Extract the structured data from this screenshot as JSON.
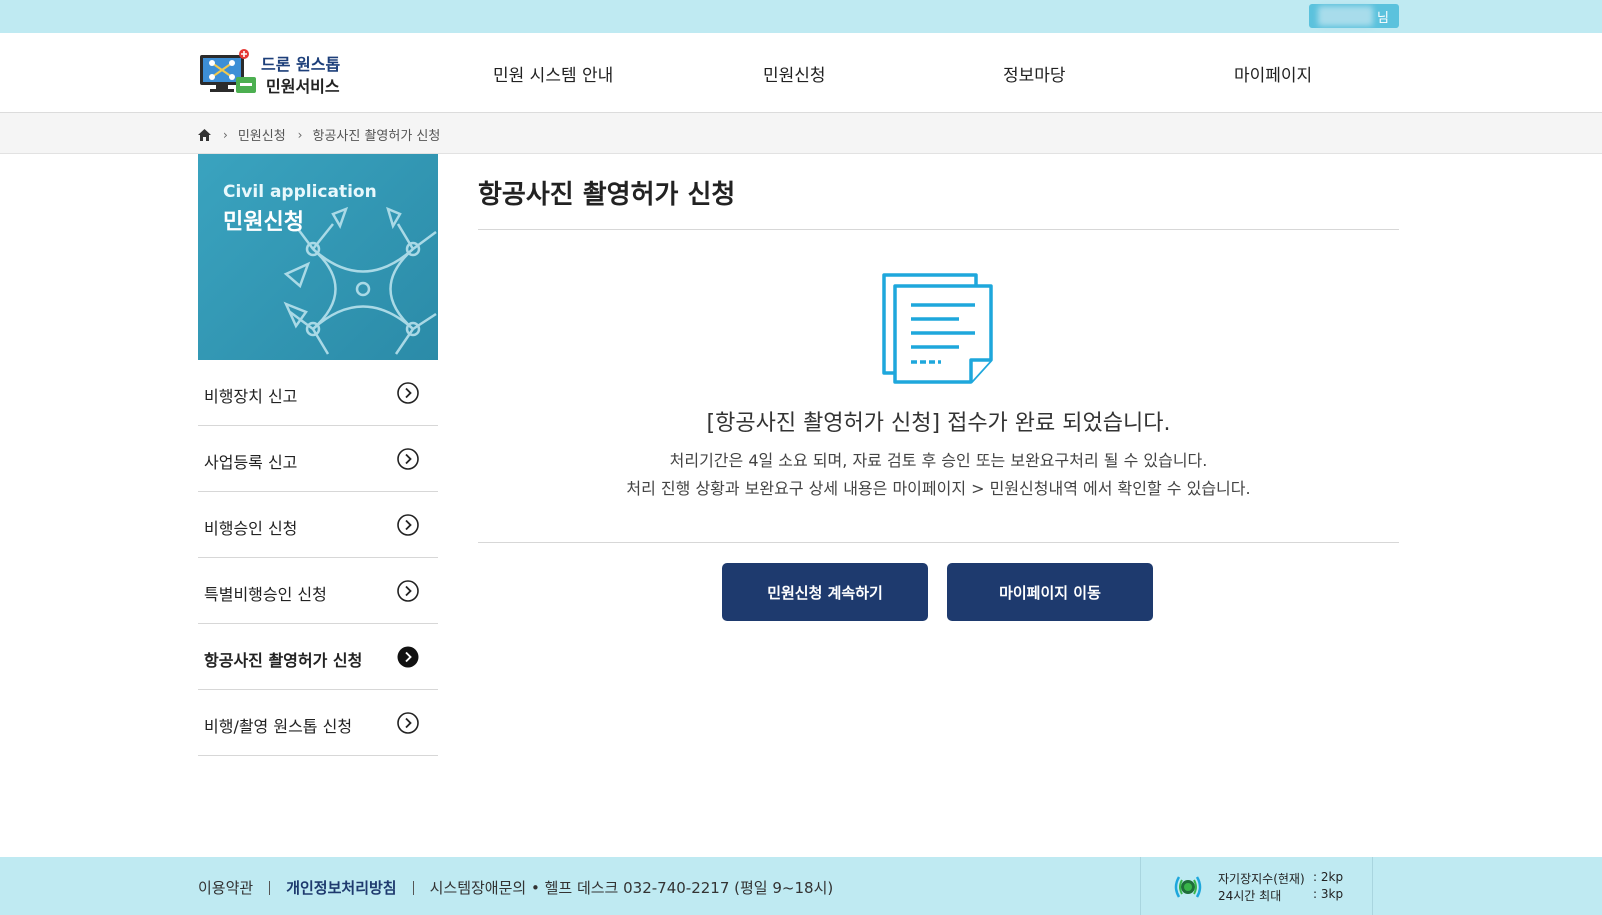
{
  "topbar": {
    "user_suffix": "님"
  },
  "header": {
    "logo_line1": "드론 원스톱",
    "logo_line2": "민원서비스",
    "nav": [
      "민원 시스템 안내",
      "민원신청",
      "정보마당",
      "마이페이지"
    ]
  },
  "breadcrumb": {
    "level1": "민원신청",
    "level2": "항공사진 촬영허가 신청",
    "sep": "›"
  },
  "side": {
    "banner_en": "Civil application",
    "banner_ko": "민원신청",
    "items": [
      {
        "label": "비행장치 신고",
        "active": false
      },
      {
        "label": "사업등록 신고",
        "active": false
      },
      {
        "label": "비행승인 신청",
        "active": false
      },
      {
        "label": "특별비행승인 신청",
        "active": false
      },
      {
        "label": "항공사진 촬영허가 신청",
        "active": true
      },
      {
        "label": "비행/촬영 원스톱 신청",
        "active": false
      }
    ]
  },
  "main": {
    "title": "항공사진 촬영허가 신청",
    "done_message": "[항공사진 촬영허가 신청] 접수가 완료 되었습니다.",
    "info_line1": "처리기간은 4일 소요 되며, 자료 검토 후 승인 또는 보완요구처리 될 수 있습니다.",
    "info_line2": "처리 진행 상황과 보완요구 상세 내용은 마이페이지 > 민원신청내역 에서 확인할 수 있습니다.",
    "btn_continue": "민원신청 계속하기",
    "btn_mypage": "마이페이지 이동"
  },
  "footer": {
    "terms": "이용약관",
    "privacy": "개인정보처리방침",
    "support": "시스템장애문의 • 헬프 데스크 032-740-2217 (평일 9~18시)",
    "kp_current_label": "자기장지수(현재)",
    "kp_current_value": ": 2kp",
    "kp_max_label": "24시간 최대",
    "kp_max_value": ": 3kp"
  },
  "colors": {
    "accent_navy": "#1e3a6e",
    "sky": "#bfeaf2",
    "teal_banner": "#2b8ba8",
    "icon_blue": "#1ea7dc"
  }
}
